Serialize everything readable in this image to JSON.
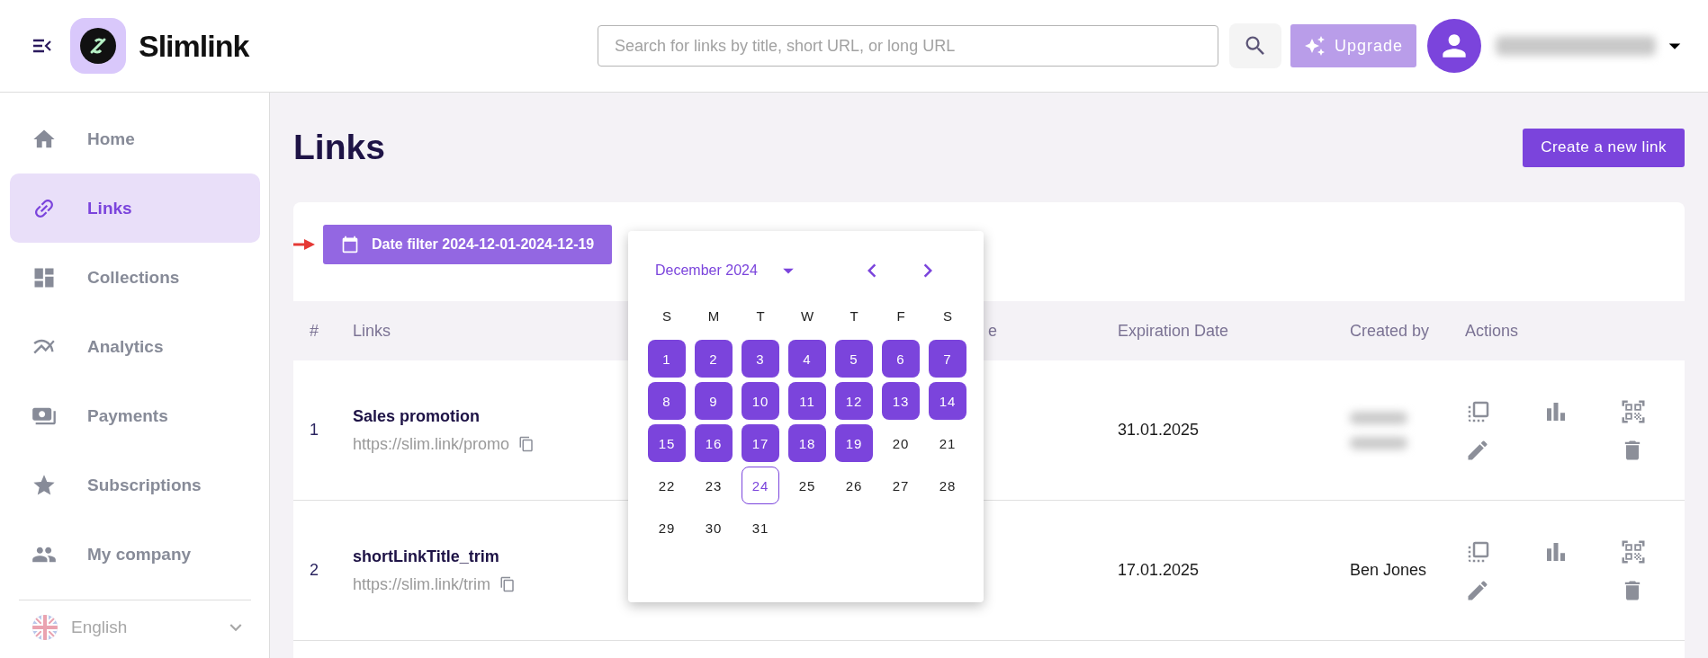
{
  "header": {
    "brand": "Slimlink",
    "search": {
      "placeholder": "Search for links by title, short URL, or long URL"
    },
    "upgrade": {
      "label": "Upgrade",
      "disabled": true
    }
  },
  "sidebar": {
    "items": [
      {
        "label": "Home",
        "selected": false
      },
      {
        "label": "Links",
        "selected": true
      },
      {
        "label": "Collections",
        "selected": false
      },
      {
        "label": "Analytics",
        "selected": false
      },
      {
        "label": "Payments",
        "selected": false
      },
      {
        "label": "Subscriptions",
        "selected": false
      },
      {
        "label": "My company",
        "selected": false
      }
    ],
    "language": "English"
  },
  "page": {
    "title": "Links",
    "create_button": "Create a new link"
  },
  "date_filter": {
    "label": "Date filter 2024-12-01-2024-12-19"
  },
  "calendar": {
    "month": "December 2024",
    "weekdays": [
      "S",
      "M",
      "T",
      "W",
      "T",
      "F",
      "S"
    ],
    "days": [
      {
        "label": "1",
        "selected": true,
        "today": false
      },
      {
        "label": "2",
        "selected": true,
        "today": false
      },
      {
        "label": "3",
        "selected": true,
        "today": false
      },
      {
        "label": "4",
        "selected": true,
        "today": false
      },
      {
        "label": "5",
        "selected": true,
        "today": false
      },
      {
        "label": "6",
        "selected": true,
        "today": false
      },
      {
        "label": "7",
        "selected": true,
        "today": false
      },
      {
        "label": "8",
        "selected": true,
        "today": false
      },
      {
        "label": "9",
        "selected": true,
        "today": false
      },
      {
        "label": "10",
        "selected": true,
        "today": false
      },
      {
        "label": "11",
        "selected": true,
        "today": false
      },
      {
        "label": "12",
        "selected": true,
        "today": false
      },
      {
        "label": "13",
        "selected": true,
        "today": false
      },
      {
        "label": "14",
        "selected": true,
        "today": false
      },
      {
        "label": "15",
        "selected": true,
        "today": false
      },
      {
        "label": "16",
        "selected": true,
        "today": false
      },
      {
        "label": "17",
        "selected": true,
        "today": false
      },
      {
        "label": "18",
        "selected": true,
        "today": false
      },
      {
        "label": "19",
        "selected": true,
        "today": false
      },
      {
        "label": "20",
        "selected": false,
        "today": false
      },
      {
        "label": "21",
        "selected": false,
        "today": false
      },
      {
        "label": "22",
        "selected": false,
        "today": false
      },
      {
        "label": "23",
        "selected": false,
        "today": false
      },
      {
        "label": "24",
        "selected": false,
        "today": true
      },
      {
        "label": "25",
        "selected": false,
        "today": false
      },
      {
        "label": "26",
        "selected": false,
        "today": false
      },
      {
        "label": "27",
        "selected": false,
        "today": false
      },
      {
        "label": "28",
        "selected": false,
        "today": false
      },
      {
        "label": "29",
        "selected": false,
        "today": false
      },
      {
        "label": "30",
        "selected": false,
        "today": false
      },
      {
        "label": "31",
        "selected": false,
        "today": false
      }
    ]
  },
  "table": {
    "columns": {
      "number": "#",
      "links": "Links",
      "column_3": "e",
      "expiration": "Expiration Date",
      "created_by": "Created by",
      "actions": "Actions"
    },
    "rows": [
      {
        "number": "1",
        "title": "Sales promotion",
        "url": "https://slim.link/promo",
        "expiration": "31.01.2025"
      },
      {
        "number": "2",
        "title": "shortLinkTitle_trim",
        "url": "https://slim.link/trim",
        "expiration": "17.01.2025",
        "created_by": "Ben Jones"
      }
    ]
  }
}
